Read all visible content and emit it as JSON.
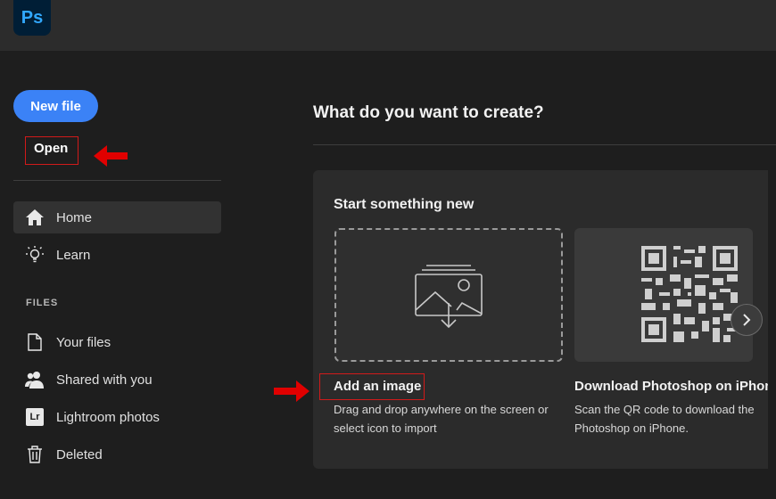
{
  "app": {
    "logo_text": "Ps"
  },
  "sidebar": {
    "new_file_label": "New file",
    "open_label": "Open",
    "nav": [
      {
        "label": "Home",
        "icon": "home-icon"
      },
      {
        "label": "Learn",
        "icon": "lightbulb-icon"
      }
    ],
    "files_heading": "FILES",
    "files": [
      {
        "label": "Your files",
        "icon": "document-icon"
      },
      {
        "label": "Shared with you",
        "icon": "people-icon"
      },
      {
        "label": "Lightroom photos",
        "icon": "lightroom-icon",
        "icon_text": "Lr"
      },
      {
        "label": "Deleted",
        "icon": "trash-icon"
      }
    ]
  },
  "main": {
    "title": "What do you want to create?",
    "panel_title": "Start something new",
    "cards": [
      {
        "title": "Add an image",
        "desc_line1": "Drag and drop anywhere on the screen or",
        "desc_line2": "select icon to import"
      },
      {
        "title": "Download Photoshop on iPhone",
        "desc_line1": "Scan the QR code to download the",
        "desc_line2": "Photoshop on iPhone."
      }
    ]
  },
  "colors": {
    "accent": "#3b82f6",
    "annotation": "#e00000",
    "logo_bg": "#001e36",
    "logo_text": "#31a8ff"
  }
}
